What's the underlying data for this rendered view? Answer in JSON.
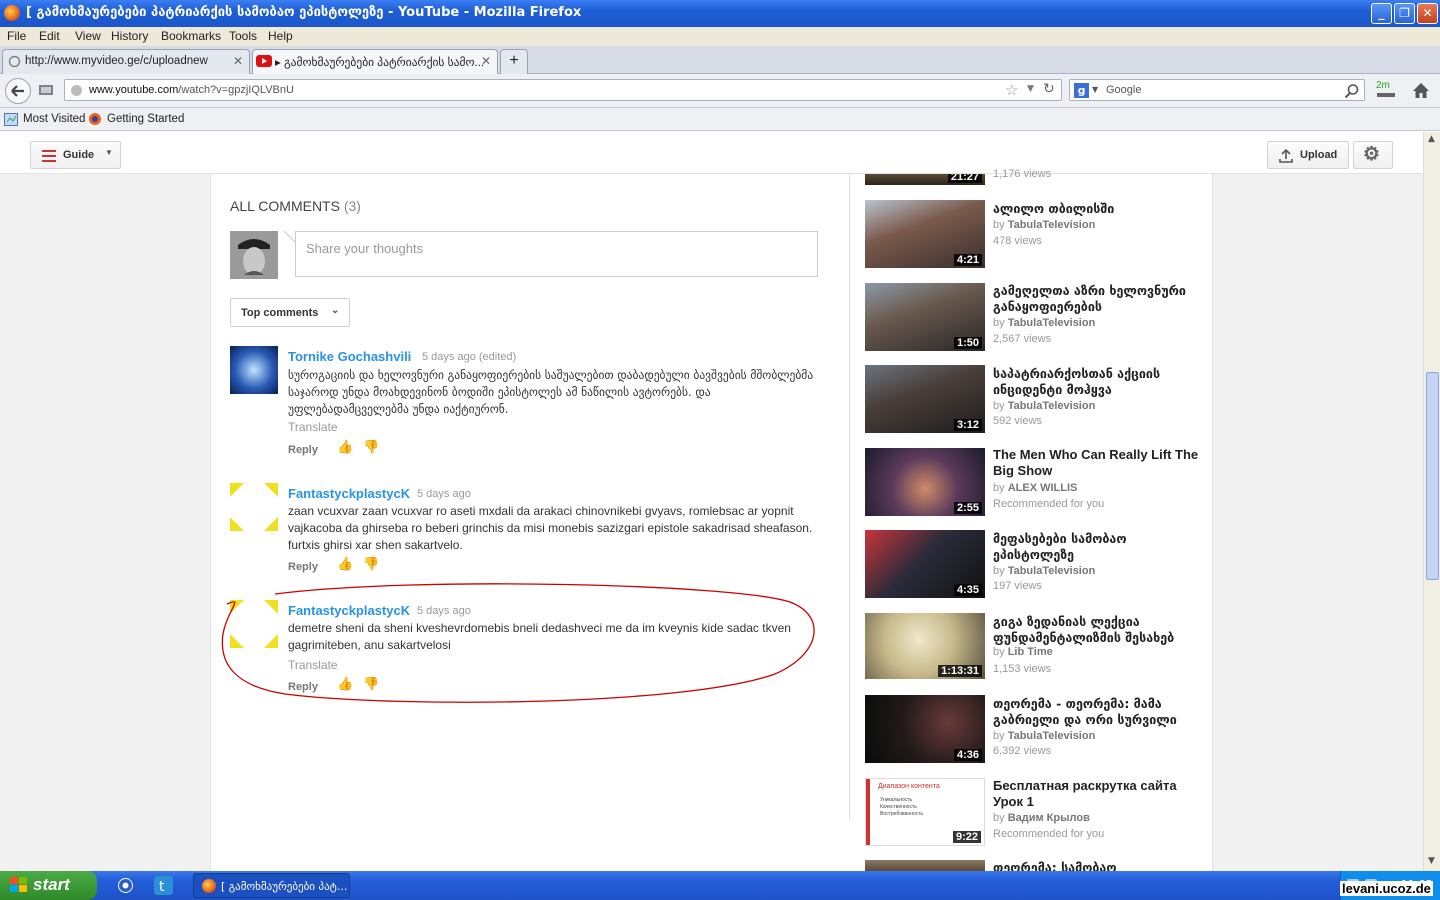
{
  "window": {
    "title": "[ გამოხმაურებები პატრიარქის სამობაო ეპისტოლეზე - YouTube - Mozilla Firefox",
    "controls": [
      "_",
      "❐",
      "✕"
    ]
  },
  "menu": [
    "File",
    "Edit",
    "View",
    "History",
    "Bookmarks",
    "Tools",
    "Help"
  ],
  "tabs": [
    {
      "label": "http://www.myvideo.ge/c/uploadnew",
      "close": "✕"
    },
    {
      "label": "▸ გამოხმაურებები პატრიარქის სამო...",
      "close": "✕"
    }
  ],
  "new_tab": "+",
  "nav": {
    "url_domain": "www.youtube.com",
    "url_path": "/watch?v=gpzjIQLVBnU",
    "search_placeholder": "Google",
    "search_engine": "g",
    "addon_badge": "2m"
  },
  "bookmarks": [
    "Most Visited",
    "Getting Started"
  ],
  "yt": {
    "guide_label": "Guide",
    "upload_label": "Upload"
  },
  "comments": {
    "header": "ALL COMMENTS",
    "count": "(3)",
    "share_placeholder": "Share your thoughts",
    "sort_label": "Top comments",
    "items": [
      {
        "author": "Tornike Gochashvili",
        "date": "5 days ago (edited)",
        "text": "სუროგაციის და ხელოვნური განაყოფიერების საშუალებით დაბადებული ბავშვების მშობლებმა საჯაროდ უნდა მოახდევინონ ბოდიში ეპისტოლეს ამ ნაწილის ავტორებს. და უფლებადამცველებმა უნდა იაქტიურონ.",
        "translate": "Translate",
        "reply": "Reply"
      },
      {
        "author": "FantastyckplastycK",
        "date": "5 days ago",
        "text": "zaan vcuxvar zaan vcuxvar ro aseti mxdali da arakaci chinovnikebi gvyavs, romlebsac ar yopnit vajkacoba da ghirseba ro beberi grinchis da misi monebis sazizgari epistole sakadrisad sheafason. furtxis ghirsi xar shen sakartvelo.",
        "translate": "",
        "reply": "Reply"
      },
      {
        "author": "FantastyckplastycK",
        "date": "5 days ago",
        "text": "demetre sheni da sheni kveshevrdomebis bneli dedashveci me da im kveynis kide sadac tkven gagrimiteben, anu sakartvelosi",
        "translate": "Translate",
        "reply": "Reply"
      }
    ]
  },
  "sidebar": [
    {
      "title": "",
      "by": "",
      "views": "1,176 views",
      "duration": "21:27"
    },
    {
      "title": "ალილო თბილისში",
      "by": "TabulaTelevision",
      "views": "478 views",
      "duration": "4:21"
    },
    {
      "title": "გამეღელთა აზრი ხელოვნური განაყოფიერების",
      "by": "TabulaTelevision",
      "views": "2,567 views",
      "duration": "1:50"
    },
    {
      "title": "საპატრიარქოსთან აქციის ინციდენტი მოჰყვა",
      "by": "TabulaTelevision",
      "views": "592 views",
      "duration": "3:12"
    },
    {
      "title": "The Men Who Can Really Lift The Big Show",
      "by": "ALEX WILLIS",
      "views": "Recommended for you",
      "duration": "2:55"
    },
    {
      "title": "მეფასებები სამობაო ეპისტოლეზე",
      "by": "TabulaTelevision",
      "views": "197 views",
      "duration": "4:35"
    },
    {
      "title": "გიგა ზედანიას ლექცია ფუნდამენტალიზმის შესახებ",
      "by": "Lib Time",
      "views": "1,153 views",
      "duration": "1:13:31"
    },
    {
      "title": "თეორემა - თეორემა: მამა გაბრიელი და ორი სურვილი",
      "by": "TabulaTelevision",
      "views": "6,392 views",
      "duration": "4:36"
    },
    {
      "title": "Бесплатная раскрутка сайта Урок 1",
      "by": "Вадим Крылов",
      "views": "Recommended for you",
      "duration": "9:22"
    },
    {
      "title": "თეორემა: სამობაო",
      "by": "",
      "views": "",
      "duration": ""
    }
  ],
  "by_prefix": "by",
  "thumb_text": {
    "diap_title": "Диапазон контента",
    "diap_items": [
      "Уникальность",
      "Качественность",
      "Востребованность"
    ]
  },
  "taskbar": {
    "start": "start",
    "task_label": "[ გამოხმაურებები პატ...",
    "clock": "11:02",
    "watermark": "levani.ucoz.de"
  },
  "colors": {
    "link": "#2793e6",
    "annotation": "#cc0000",
    "xp_blue": "#245edb"
  }
}
